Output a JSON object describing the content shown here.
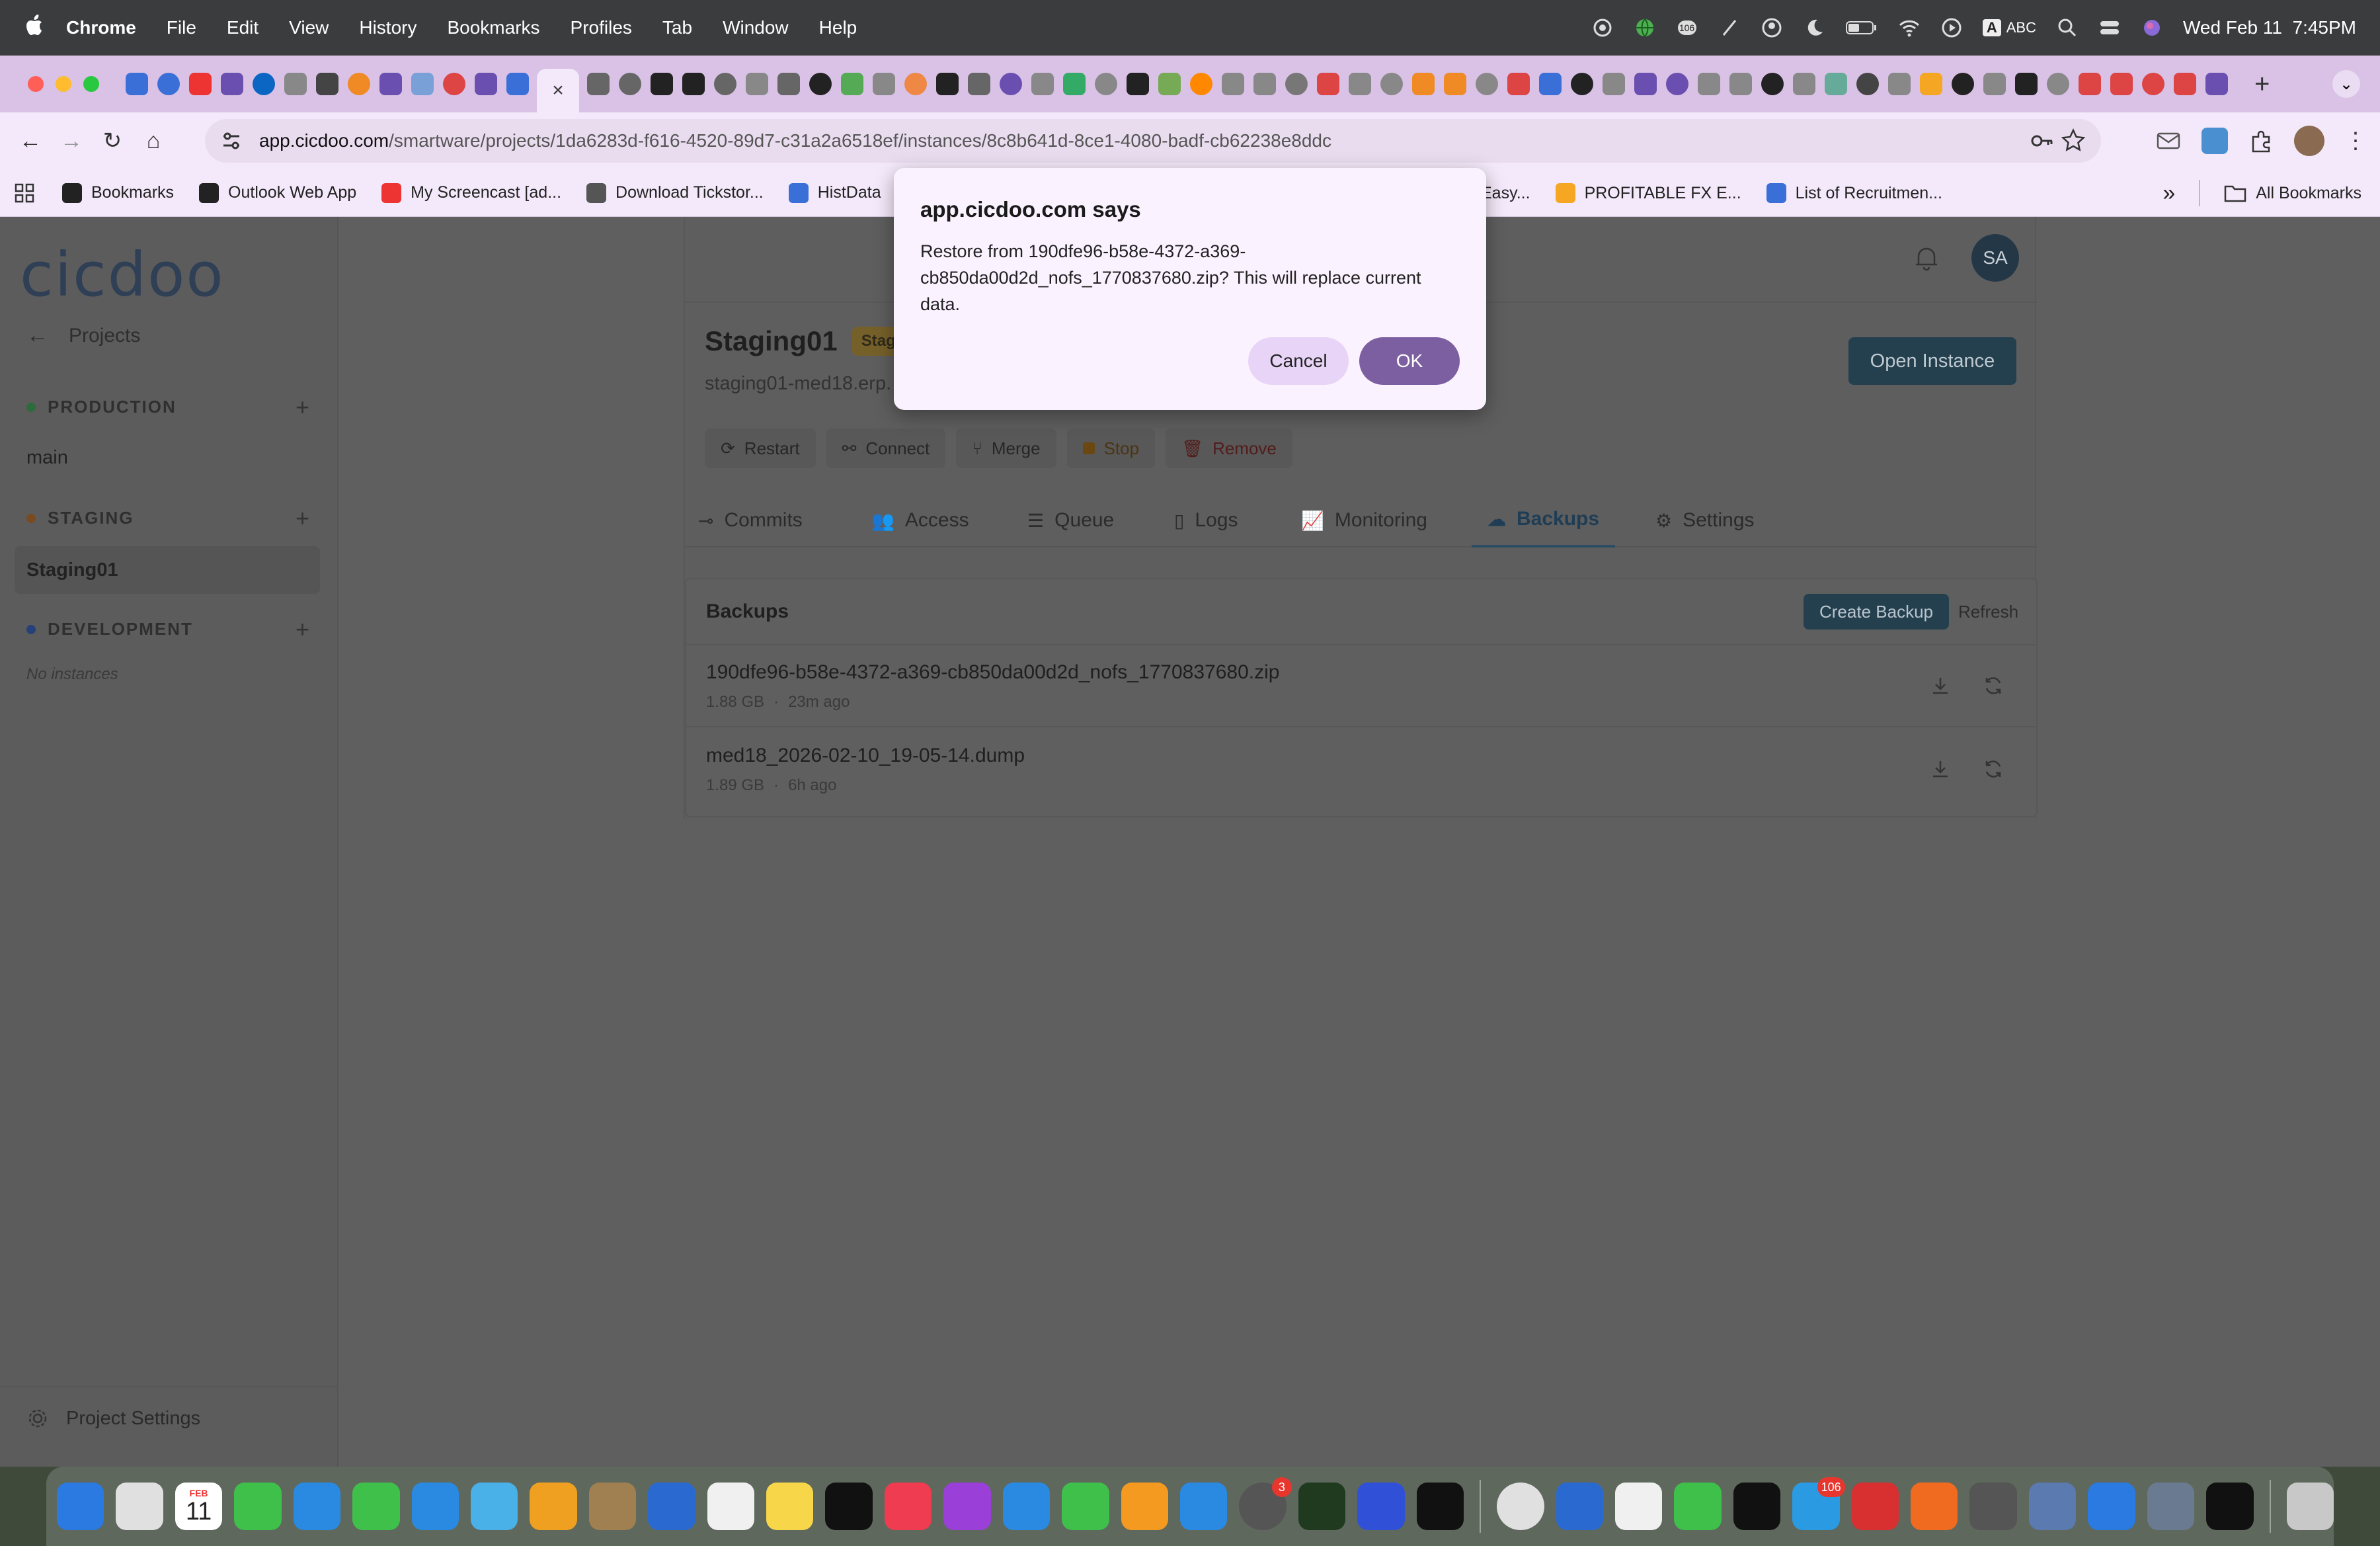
{
  "menubar": {
    "app": "Chrome",
    "items": [
      "File",
      "Edit",
      "View",
      "History",
      "Bookmarks",
      "Profiles",
      "Tab",
      "Window",
      "Help"
    ],
    "input_label": "ABC",
    "input_key": "A",
    "clock": "Wed Feb 11  7:45PM",
    "badge_count": "106"
  },
  "tabs": {
    "active_close": "×",
    "new_tab": "+",
    "tab_icon_colors": [
      "#3b6fd8",
      "#3b6fd8",
      "#e33",
      "#6b4fb0",
      "#0a66c2",
      "#888",
      "#444",
      "#f08a24",
      "#6b4fb0",
      "#7aa0d8",
      "#d44",
      "#6b4fb0",
      "#3b6fd8"
    ],
    "tab_icon_colors_after": [
      "#666",
      "#666",
      "#222",
      "#222",
      "#666",
      "#888",
      "#666",
      "#222",
      "#5a5",
      "#888",
      "#e84",
      "#222",
      "#666",
      "#6b4fb0",
      "#888",
      "#3a6",
      "#888",
      "#222",
      "#7a5",
      "#f80",
      "#888",
      "#888",
      "#777",
      "#d44",
      "#888",
      "#888",
      "#f08a24",
      "#f08a24",
      "#888",
      "#d44",
      "#3b6fd8",
      "#222",
      "#888",
      "#6b4fb0",
      "#6b4fb0",
      "#888",
      "#888",
      "#222",
      "#888",
      "#6a9",
      "#444",
      "#888",
      "#f5a623",
      "#222",
      "#888",
      "#222",
      "#888",
      "#d44",
      "#d44",
      "#d44",
      "#d44",
      "#6b4fb0",
      "#3b6fd8",
      "#3b6fd8",
      "#888",
      "#e33",
      "#888",
      "#3b6fd8"
    ]
  },
  "toolbar": {
    "url_host": "app.cicdoo.com",
    "url_path": "/smartware/projects/1da6283d-f616-4520-89d7-c31a2a6518ef/instances/8c8b641d-8ce1-4080-badf-cb62238e8ddc"
  },
  "bookmarks": {
    "items": [
      {
        "label": "Bookmarks",
        "color": "#222"
      },
      {
        "label": "Outlook Web App",
        "color": "#222"
      },
      {
        "label": "My Screencast [ad...",
        "color": "#e33"
      },
      {
        "label": "Download Tickstor...",
        "color": "#555"
      },
      {
        "label": "HistData",
        "color": "#3b6fd8"
      }
    ],
    "items_right": [
      {
        "label": "Easy...",
        "color": ""
      },
      {
        "label": "PROFITABLE FX E...",
        "color": "#f5a623"
      },
      {
        "label": "List of Recruitmen...",
        "color": "#3b6fd8"
      }
    ],
    "overflow": "»",
    "all_bookmarks": "All Bookmarks"
  },
  "sidebar": {
    "logo": "cicdoo",
    "back_label": "Projects",
    "sections": [
      {
        "label": "PRODUCTION",
        "color": "#2d6b3a"
      },
      {
        "label": "STAGING",
        "color": "#7a4a20"
      },
      {
        "label": "DEVELOPMENT",
        "color": "#26417a"
      }
    ],
    "production_items": [
      "main"
    ],
    "staging_items": [
      "Staging01"
    ],
    "development_empty": "No instances",
    "project_settings": "Project Settings"
  },
  "instance": {
    "title": "Staging01",
    "badge": "Stagi",
    "subtitle": "staging01-med18.erp.",
    "avatar": "SA",
    "open_button": "Open Instance",
    "actions": [
      {
        "label": "Restart",
        "icon": "⟳"
      },
      {
        "label": "Connect",
        "icon": "⚯"
      },
      {
        "label": "Merge",
        "icon": "⑂"
      },
      {
        "label": "Stop",
        "icon": ""
      },
      {
        "label": "Remove",
        "icon": "🗑"
      }
    ],
    "tabs": [
      {
        "label": "Commits",
        "icon": "⊸"
      },
      {
        "label": "Access",
        "icon": "👥"
      },
      {
        "label": "Queue",
        "icon": "☰"
      },
      {
        "label": "Logs",
        "icon": "▯"
      },
      {
        "label": "Monitoring",
        "icon": "📈"
      },
      {
        "label": "Backups",
        "icon": "☁"
      },
      {
        "label": "Settings",
        "icon": "⚙"
      }
    ]
  },
  "backups": {
    "title": "Backups",
    "create_label": "Create Backup",
    "refresh_label": "Refresh",
    "rows": [
      {
        "name": "190dfe96-b58e-4372-a369-cb850da00d2d_nofs_1770837680.zip",
        "size": "1.88 GB",
        "sep": "·",
        "age": "23m ago"
      },
      {
        "name": "med18_2026-02-10_19-05-14.dump",
        "size": "1.89 GB",
        "sep": "·",
        "age": "6h ago"
      }
    ]
  },
  "dialog": {
    "title": "app.cicdoo.com says",
    "message": "Restore from 190dfe96-b58e-4372-a369-cb850da00d2d_nofs_1770837680.zip? This will replace current data.",
    "cancel": "Cancel",
    "ok": "OK"
  },
  "dock": {
    "calendar_month": "FEB",
    "calendar_day": "11",
    "settings_badge": "3",
    "telegram_badge": "106",
    "apps_left": [
      "#2a7ae2",
      "#e0e0e0",
      "#ffffff",
      "#3fc04a",
      "#2a8ae2",
      "#3fc04a",
      "#2a8ae2",
      "#4ab0e8",
      "#f0a020",
      "#a08050",
      "#2a6ad0",
      "#f0f0f0",
      "#f7d64a",
      "#111111",
      "#f03c50",
      "#9a40d8",
      "#2a8ae2",
      "#3fc04a",
      "#f59a20",
      "#2a8ae2",
      "#555555",
      "#1f3a1f",
      "#3050d8",
      "#111111"
    ],
    "apps_right": [
      "#e0e0e0",
      "#2a6ad0",
      "#f0f0f0",
      "#3fc04a",
      "#111111",
      "#2a9ae2",
      "#d83030",
      "#f06a20",
      "#555555",
      "#5a7ab0",
      "#2a7ae2",
      "#6a7a90",
      "#111111"
    ]
  }
}
